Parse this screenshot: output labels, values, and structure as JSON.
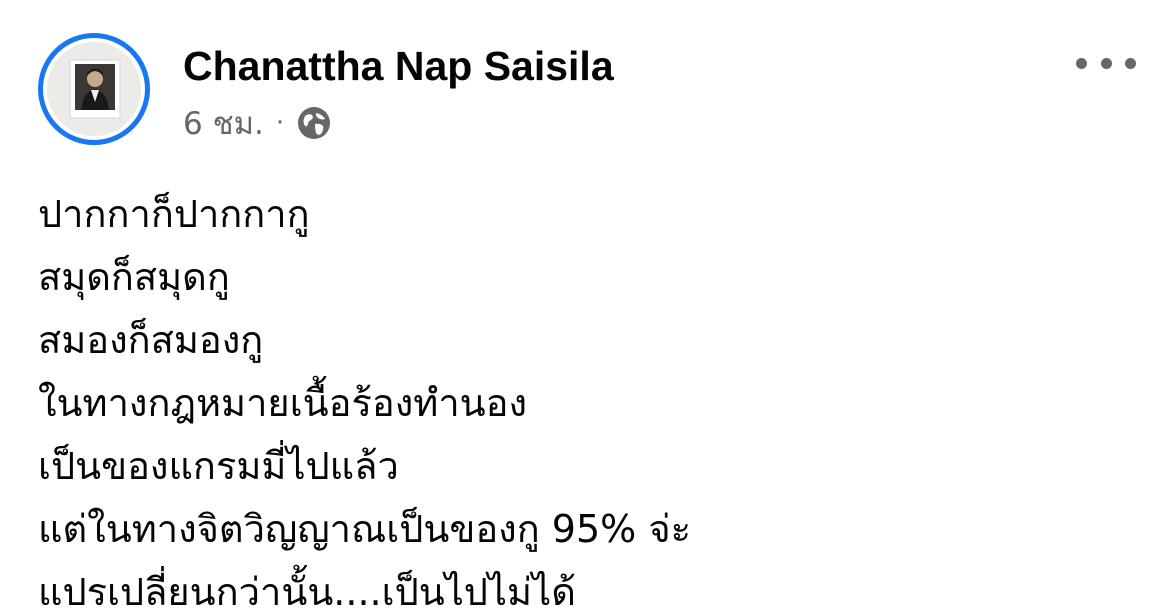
{
  "post": {
    "author": "Chanattha Nap Saisila",
    "timestamp": "6 ชม.",
    "separator": "·",
    "audience_icon": "globe-icon",
    "more_icon": "more-options-icon",
    "lines": [
      "ปากกาก็ปากกากู",
      "สมุดก็สมุดกู",
      "สมองก็สมองกู",
      "ในทางกฎหมายเนื้อร้องทำนอง",
      "เป็นของแกรมมี่ไปแล้ว",
      "แต่ในทางจิตวิญญาณเป็นของกู 95% จ่ะ",
      "แปรเปลี่ยนกว่านั้น....เป็นไปไม่ได้"
    ]
  },
  "colors": {
    "accent": "#1877f2",
    "text_primary": "#050505",
    "text_secondary": "#65676b",
    "background": "#ffffff"
  }
}
